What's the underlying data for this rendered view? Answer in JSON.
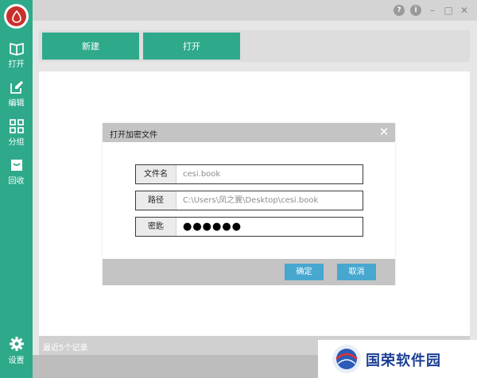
{
  "sidebar": {
    "items": [
      {
        "label": "打开",
        "icon": "book-icon"
      },
      {
        "label": "编辑",
        "icon": "edit-icon"
      },
      {
        "label": "分组",
        "icon": "grid-icon"
      },
      {
        "label": "回收",
        "icon": "recycle-bin-icon"
      }
    ],
    "settings_label": "设置"
  },
  "window_controls": [
    "?",
    "i",
    "–",
    "□",
    "✕"
  ],
  "toolbar": {
    "new_label": "新建",
    "open_label": "打开"
  },
  "dialog": {
    "title": "打开加密文件",
    "fields": [
      {
        "label": "文件名",
        "value": "cesi.book"
      },
      {
        "label": "路径",
        "value": "C:\\Users\\凤之翼\\Desktop\\cesi.book"
      },
      {
        "label": "密匙",
        "value": "●●●●●●"
      }
    ],
    "confirm_label": "确定",
    "cancel_label": "取消"
  },
  "status": {
    "recent_text": "最近5个记录"
  },
  "watermark": {
    "text": "国荣软件园"
  },
  "colors": {
    "accent": "#2eaa8b",
    "dialog_button": "#48a7cf",
    "logo_red": "#c9302c"
  }
}
